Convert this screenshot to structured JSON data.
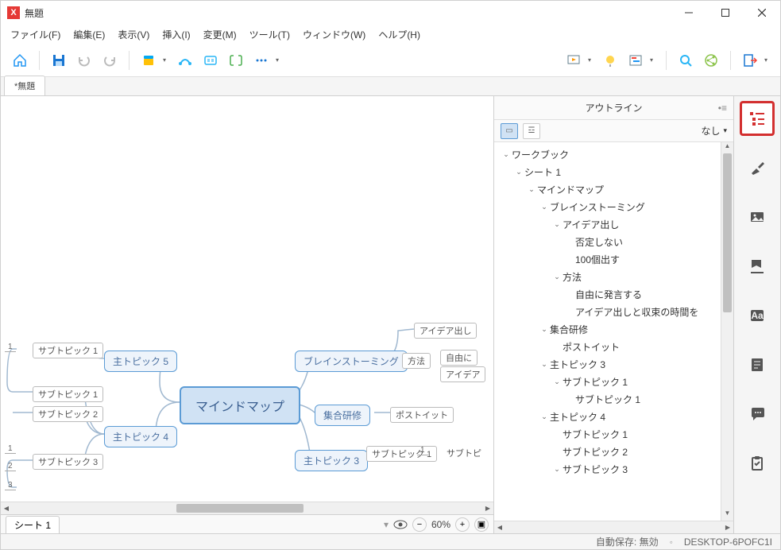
{
  "window": {
    "title": "無題"
  },
  "menu": {
    "file": "ファイル(F)",
    "edit": "編集(E)",
    "view": "表示(V)",
    "insert": "挿入(I)",
    "modify": "変更(M)",
    "tools": "ツール(T)",
    "window": "ウィンドウ(W)",
    "help": "ヘルプ(H)"
  },
  "tabs": {
    "active": "*無題"
  },
  "sheet": {
    "name": "シート 1"
  },
  "zoom": {
    "value": "60%"
  },
  "mindmap": {
    "central": "マインドマップ",
    "topic5": "主トピック 5",
    "topic4": "主トピック 4",
    "topic3": "主トピック 3",
    "brainstorming": "ブレインストーミング",
    "training": "集合研修",
    "sub1": "サブトピック 1",
    "sub2": "サブトピック 2",
    "sub3": "サブトピック 3",
    "idea_out": "アイデア出し",
    "methods": "方法",
    "postit": "ポストイット",
    "idx1": "1",
    "idx2": "2",
    "idx3": "3",
    "free": "自由に",
    "idea2": "アイデア"
  },
  "outline": {
    "title": "アウトライン",
    "filter_none": "なし",
    "tree": [
      {
        "level": 0,
        "open": true,
        "label": "ワークブック"
      },
      {
        "level": 1,
        "open": true,
        "label": "シート 1"
      },
      {
        "level": 2,
        "open": true,
        "label": "マインドマップ"
      },
      {
        "level": 3,
        "open": true,
        "label": "ブレインストーミング"
      },
      {
        "level": 4,
        "open": true,
        "label": "アイデア出し"
      },
      {
        "level": 5,
        "open": false,
        "label": "否定しない"
      },
      {
        "level": 5,
        "open": false,
        "label": "100個出す"
      },
      {
        "level": 4,
        "open": true,
        "label": "方法"
      },
      {
        "level": 5,
        "open": false,
        "label": "自由に発言する"
      },
      {
        "level": 5,
        "open": false,
        "label": "アイデア出しと収束の時間を"
      },
      {
        "level": 3,
        "open": true,
        "label": "集合研修"
      },
      {
        "level": 4,
        "open": false,
        "label": "ポストイット"
      },
      {
        "level": 3,
        "open": true,
        "label": "主トピック 3"
      },
      {
        "level": 4,
        "open": true,
        "label": "サブトピック 1"
      },
      {
        "level": 5,
        "open": false,
        "label": "サブトピック 1"
      },
      {
        "level": 3,
        "open": true,
        "label": "主トピック 4"
      },
      {
        "level": 4,
        "open": false,
        "label": "サブトピック 1"
      },
      {
        "level": 4,
        "open": false,
        "label": "サブトピック 2"
      },
      {
        "level": 4,
        "open": true,
        "label": "サブトピック 3"
      }
    ]
  },
  "status": {
    "autosave": "自動保存: 無効",
    "host": "DESKTOP-6POFC1I"
  }
}
